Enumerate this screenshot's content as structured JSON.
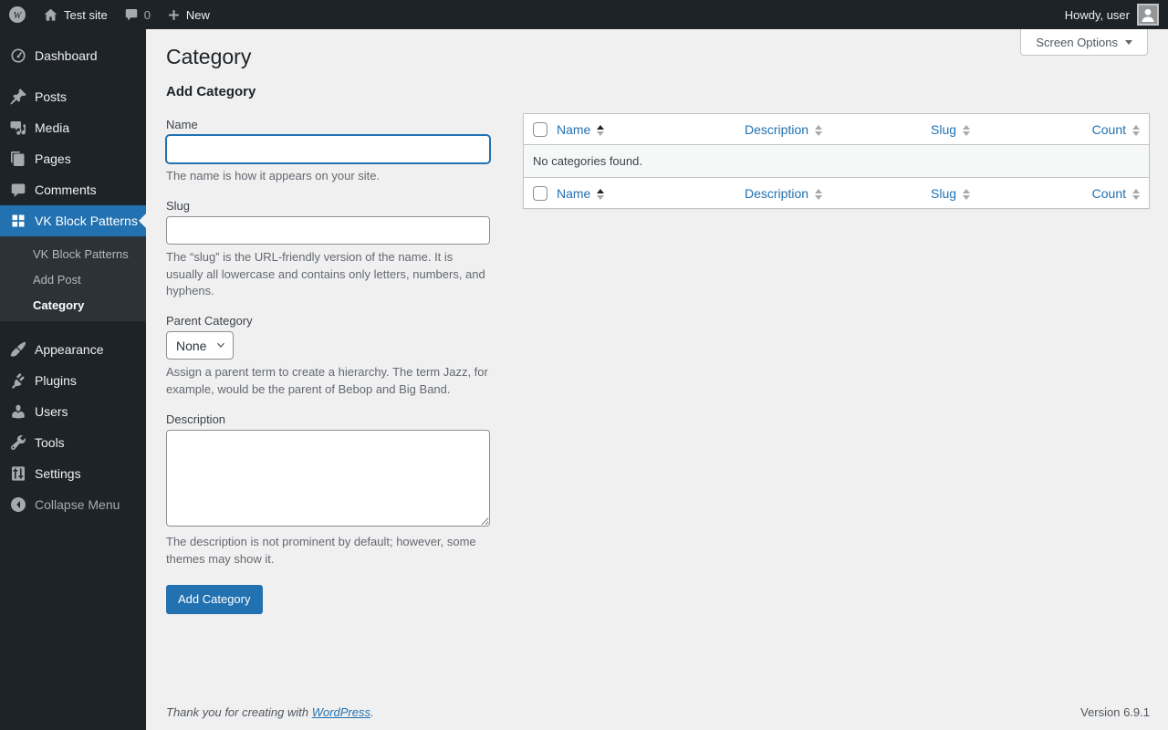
{
  "admin_bar": {
    "site_name": "Test site",
    "comments_count": "0",
    "new_label": "New",
    "howdy": "Howdy, user"
  },
  "sidebar": {
    "items": {
      "dashboard": "Dashboard",
      "posts": "Posts",
      "media": "Media",
      "pages": "Pages",
      "comments": "Comments",
      "vk_block_patterns": "VK Block Patterns",
      "appearance": "Appearance",
      "plugins": "Plugins",
      "users": "Users",
      "tools": "Tools",
      "settings": "Settings",
      "collapse": "Collapse Menu"
    },
    "submenu": {
      "vk_block_patterns": "VK Block Patterns",
      "add_post": "Add Post",
      "category": "Category"
    }
  },
  "page": {
    "title": "Category",
    "screen_options_label": "Screen Options"
  },
  "form": {
    "heading": "Add Category",
    "name": {
      "label": "Name",
      "value": "",
      "help": "The name is how it appears on your site."
    },
    "slug": {
      "label": "Slug",
      "value": "",
      "help": "The “slug” is the URL-friendly version of the name. It is usually all lowercase and contains only letters, numbers, and hyphens."
    },
    "parent": {
      "label": "Parent Category",
      "selected": "None",
      "help": "Assign a parent term to create a hierarchy. The term Jazz, for example, would be the parent of Bebop and Big Band."
    },
    "description": {
      "label": "Description",
      "value": "",
      "help": "The description is not prominent by default; however, some themes may show it."
    },
    "submit_label": "Add Category"
  },
  "table": {
    "columns": {
      "name": "Name",
      "description": "Description",
      "slug": "Slug",
      "count": "Count"
    },
    "empty_message": "No categories found."
  },
  "footer": {
    "thanks_prefix": "Thank you for creating with ",
    "wordpress_link": "WordPress",
    "thanks_suffix": ".",
    "version": "Version 6.9.1"
  },
  "colors": {
    "accent": "#2271b1",
    "adminbar_bg": "#1d2327",
    "submenu_bg": "#2c3338",
    "content_bg": "#f0f0f1"
  }
}
